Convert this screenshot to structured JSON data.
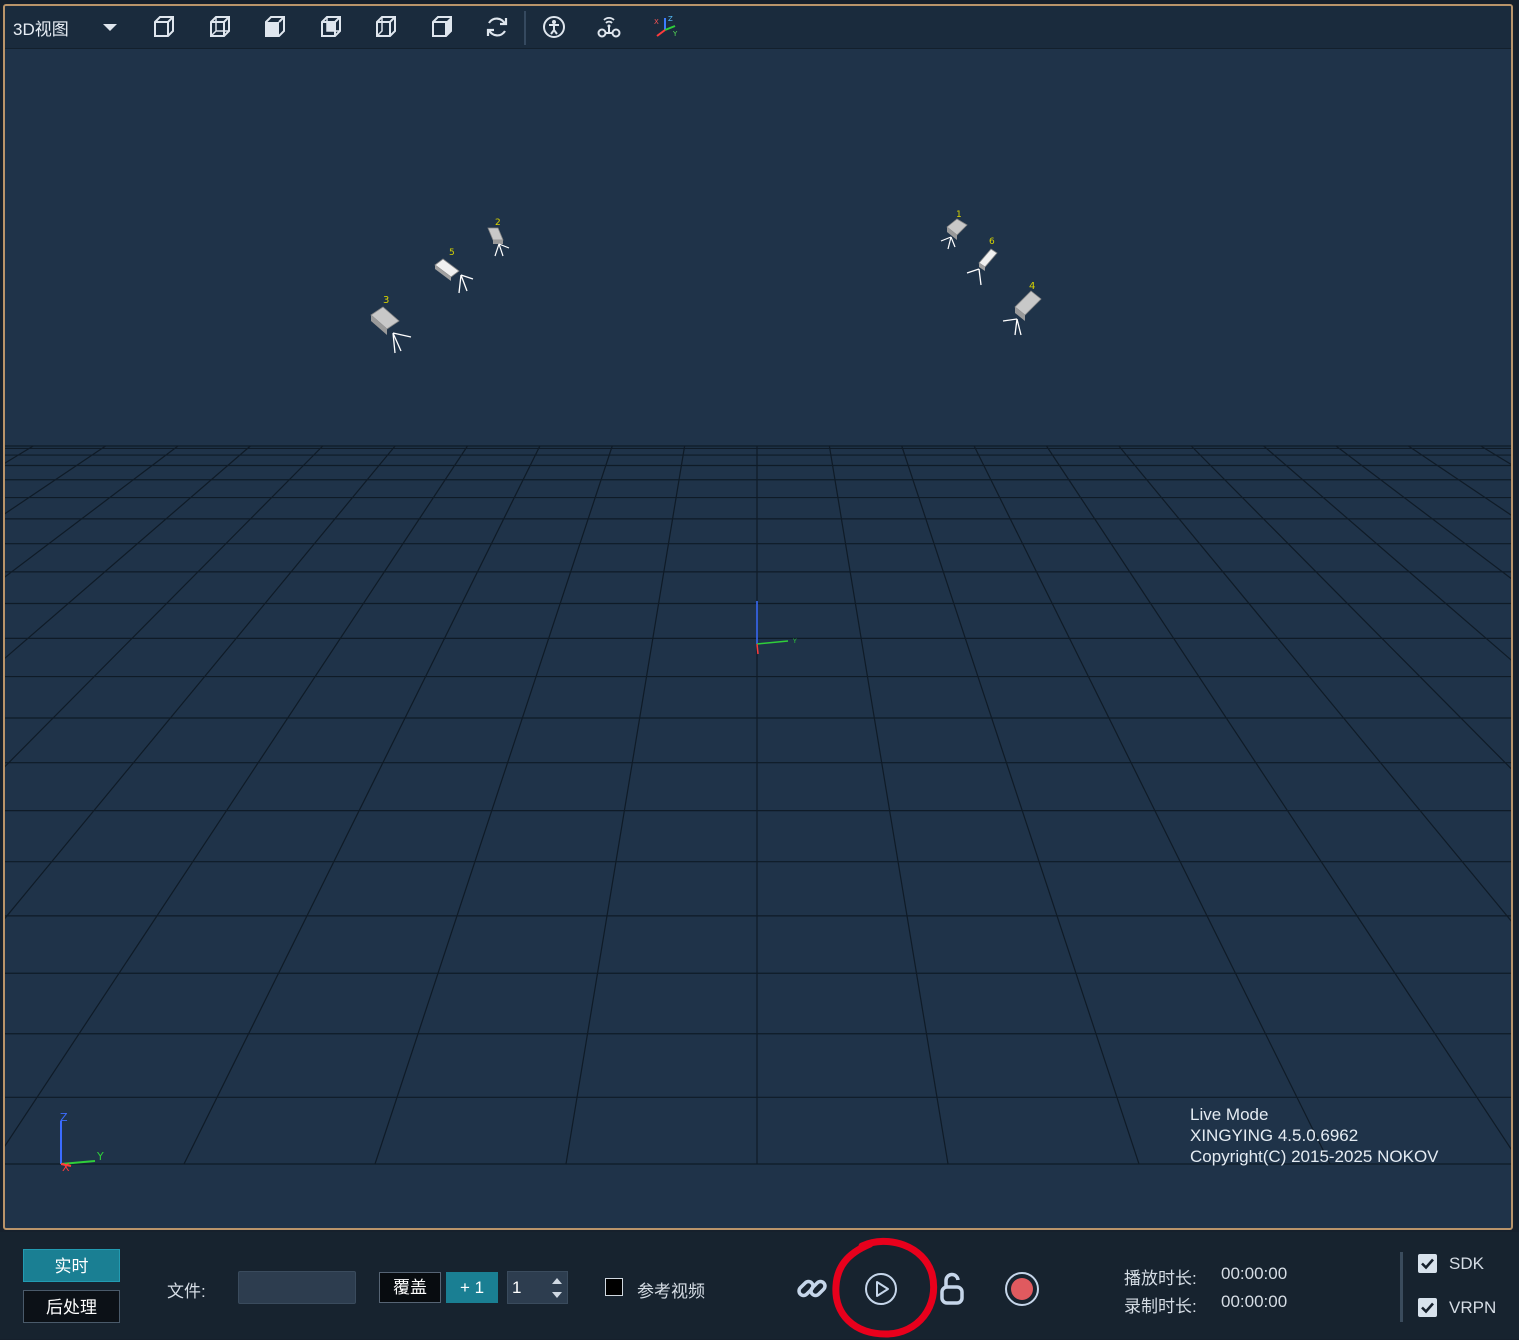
{
  "toolbar": {
    "view_label": "3D视图",
    "icons": [
      "cube-front-icon",
      "cube-back-icon",
      "cube-side-icon",
      "cube-top-icon",
      "cube-bottom-icon",
      "cube-right-icon",
      "refresh-icon",
      "skeleton-icon",
      "device-icon",
      "axis-icon"
    ]
  },
  "scene": {
    "cameras": [
      "1",
      "2",
      "3",
      "4",
      "5",
      "6"
    ],
    "origin_axis": {
      "y_label": "Y"
    },
    "corner_axis": {
      "z_label": "Z",
      "y_label": "Y",
      "x_label": "X"
    },
    "status": {
      "mode": "Live Mode",
      "version": "XINGYING 4.5.0.6962",
      "copyright": "Copyright(C) 2015-2025 NOKOV"
    }
  },
  "bottom": {
    "realtime_label": "实时",
    "postprocess_label": "后处理",
    "file_label": "文件:",
    "file_value": "",
    "overwrite_label": "覆盖",
    "increment_label": "+ 1",
    "spin_value": "1",
    "reference_video_label": "参考视频",
    "reference_video_checked": false,
    "playback_duration_label": "播放时长:",
    "playback_duration_value": "00:00:00",
    "record_duration_label": "录制时长:",
    "record_duration_value": "00:00:00",
    "sdk_label": "SDK",
    "sdk_checked": true,
    "vrpn_label": "VRPN",
    "vrpn_checked": true
  },
  "colors": {
    "accent": "#1a7f93",
    "frame_border": "#b9946a",
    "viewport_bg": "#1f3349",
    "record": "#e05a5f",
    "annotation_red": "#e8001c",
    "camera_label": "#d8d400"
  }
}
